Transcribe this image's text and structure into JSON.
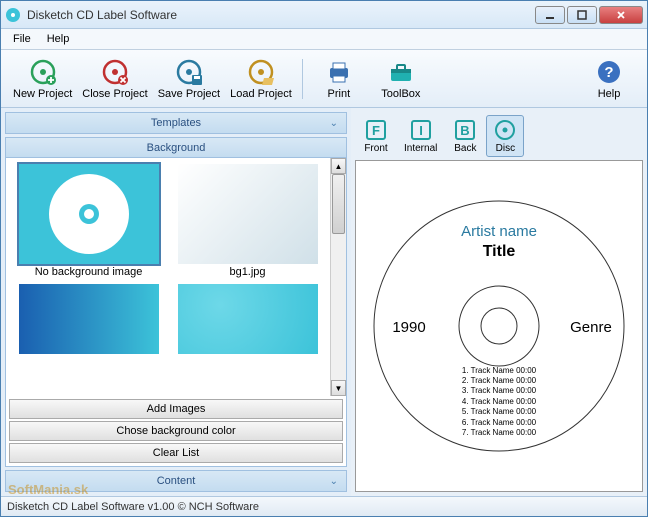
{
  "window": {
    "title": "Disketch CD Label Software"
  },
  "menu": {
    "file": "File",
    "help": "Help"
  },
  "toolbar": {
    "new_project": "New Project",
    "close_project": "Close Project",
    "save_project": "Save Project",
    "load_project": "Load Project",
    "print": "Print",
    "toolbox": "ToolBox",
    "help": "Help"
  },
  "left": {
    "templates": "Templates",
    "background": "Background",
    "content": "Content",
    "thumbs": [
      {
        "label": "No background image"
      },
      {
        "label": "bg1.jpg"
      },
      {
        "label": ""
      },
      {
        "label": ""
      }
    ],
    "add_images": "Add Images",
    "choose_bg": "Chose background color",
    "clear_list": "Clear List"
  },
  "views": {
    "front": "Front",
    "internal": "Internal",
    "back": "Back",
    "disc": "Disc"
  },
  "disc": {
    "artist": "Artist name",
    "title": "Title",
    "year": "1990",
    "genre": "Genre",
    "tracks": [
      "1. Track Name 00:00",
      "2. Track Name 00:00",
      "3. Track Name 00:00",
      "4. Track Name 00:00",
      "5. Track Name 00:00",
      "6. Track Name 00:00",
      "7. Track Name 00:00"
    ]
  },
  "status": "Disketch CD Label Software v1.00 © NCH Software",
  "watermark": "SoftMania.sk"
}
